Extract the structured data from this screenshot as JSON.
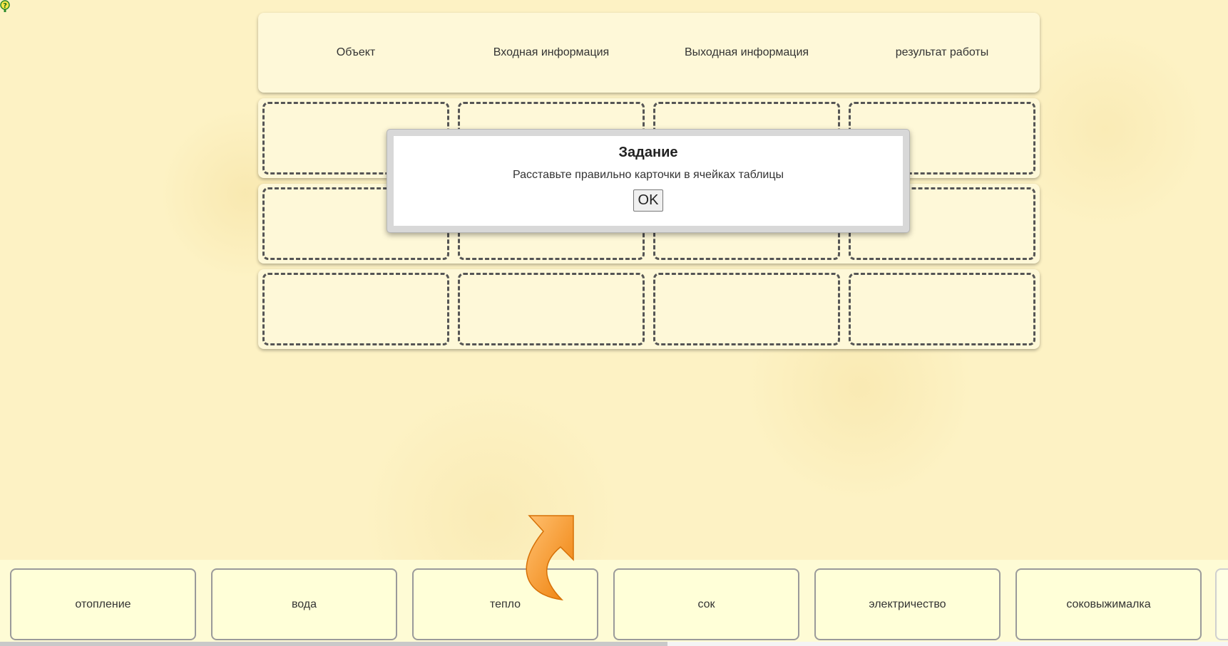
{
  "table": {
    "headers": [
      "Объект",
      "Входная информация",
      "Выходная информация",
      "результат работы"
    ],
    "row_count": 3,
    "column_count": 4
  },
  "modal": {
    "title": "Задание",
    "text": "Расставьте правильно карточки в ячейках таблицы",
    "ok_label": "OK"
  },
  "cards": [
    "отопление",
    "вода",
    "тепло",
    "сок",
    "электричество",
    "соковыжималка"
  ],
  "icons": {
    "help": "help-question-icon",
    "hint": "curved-arrow-icon"
  },
  "colors": {
    "background": "#fdf2c4",
    "panel": "#fef8d8",
    "card": "#ffffd8",
    "arrow": "#f28c16"
  }
}
